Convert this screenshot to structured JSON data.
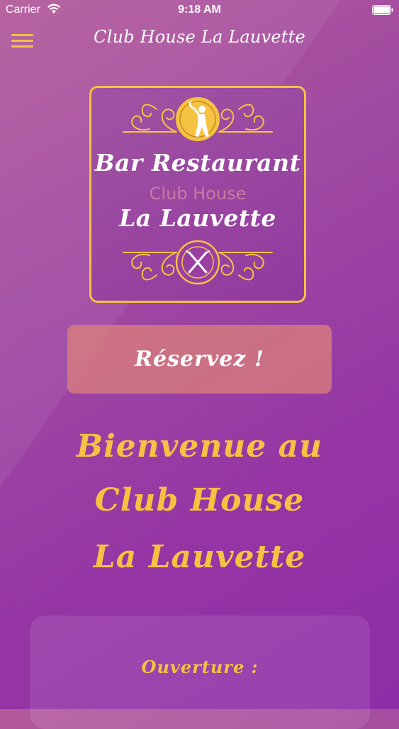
{
  "status_bar": {
    "carrier": "Carrier",
    "time": "9:18 AM"
  },
  "nav": {
    "title": "Club House La Lauvette",
    "menu_icon": "hamburger-menu-icon"
  },
  "logo": {
    "line1": "Bar Restaurant",
    "line2": "Club House",
    "line3": "La Lauvette",
    "top_emblem_icon": "golfer-icon",
    "bottom_emblem_icon": "fork-knife-icon"
  },
  "reserve_button": {
    "label": "Réservez !"
  },
  "welcome": {
    "line1": "Bienvenue au",
    "line2": "Club House",
    "line3": "La Lauvette"
  },
  "info": {
    "heading": "Ouverture :"
  },
  "colors": {
    "accent": "#f5c242",
    "background": "#9535a5",
    "button": "#de8478",
    "text": "#ffffff"
  }
}
